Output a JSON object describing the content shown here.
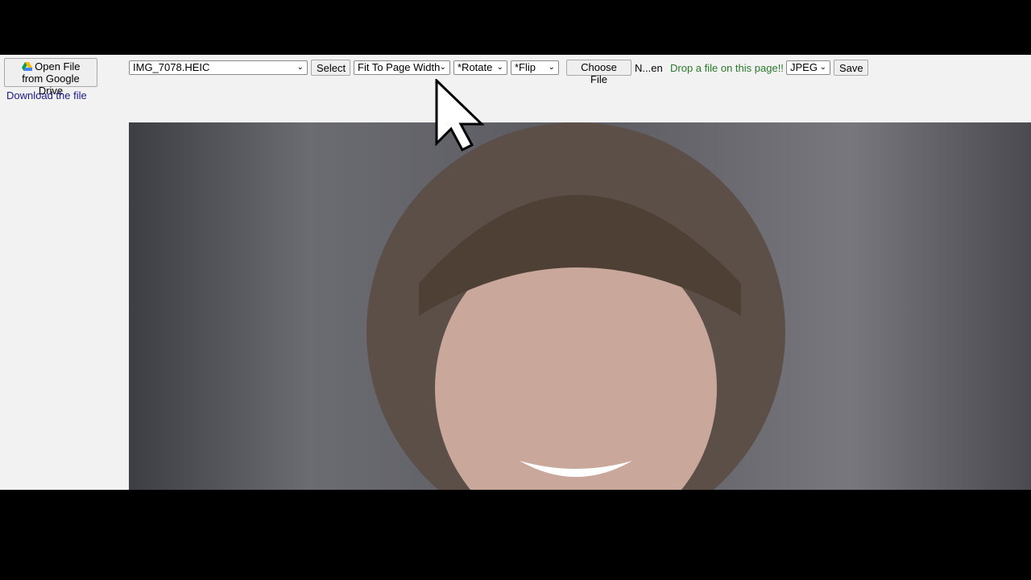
{
  "google_drive": {
    "label_line1": "Open File",
    "label_line2": "from Google Drive",
    "icon": "google-drive-icon"
  },
  "download_link": "Download the file",
  "file_select": {
    "value": "IMG_7078.HEIC"
  },
  "select_button": "Select",
  "zoom_select": {
    "value": "Fit To Page Width"
  },
  "rotate_select": {
    "value": "*Rotate"
  },
  "flip_select": {
    "value": "*Flip"
  },
  "file_input": {
    "button": "Choose File",
    "status": "N...en"
  },
  "drop_hint": "Drop a file on this page!!",
  "format_select": {
    "value": "JPEG"
  },
  "save_button": "Save",
  "colors": {
    "drop_hint": "#2a7a2a",
    "link": "#1a1a8c",
    "background": "#f2f2f2"
  }
}
